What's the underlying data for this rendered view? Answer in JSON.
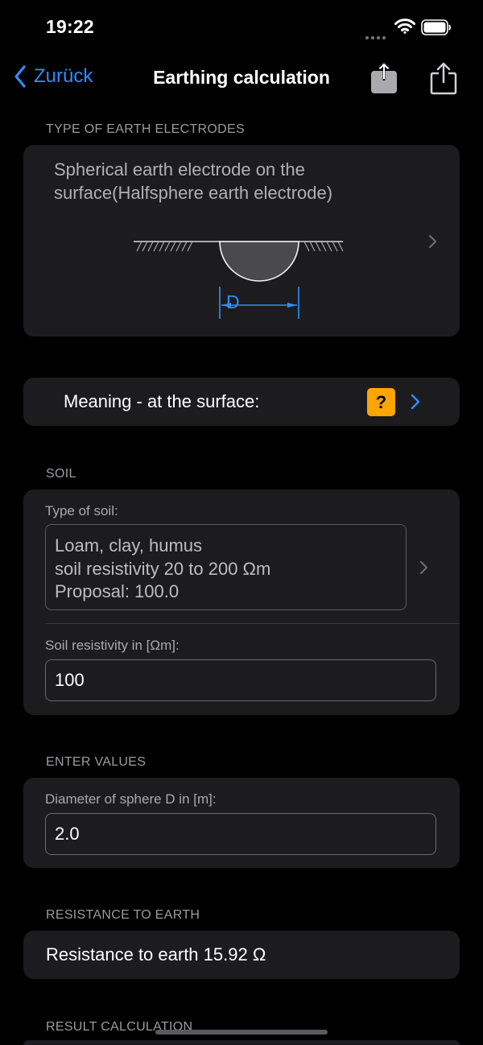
{
  "status": {
    "time": "19:22"
  },
  "nav": {
    "back_label": "Zurück",
    "title": "Earthing calculation"
  },
  "electrode_section": {
    "header": "TYPE OF EARTH ELECTRODES",
    "title": "Spherical earth electrode on the surface(Halfsphere earth electrode)",
    "dimension_label": "D"
  },
  "meaning": {
    "label": "Meaning - at the surface:",
    "help_symbol": "?"
  },
  "soil_section": {
    "header": "SOIL",
    "type_label": "Type of soil:",
    "type_lines": [
      "Loam, clay, humus",
      "soil resistivity 20 to 200 Ωm",
      "Proposal: 100.0"
    ],
    "resistivity_label": "Soil resistivity in [Ωm]:",
    "resistivity_value": "100"
  },
  "values_section": {
    "header": "ENTER VALUES",
    "diameter_label": "Diameter of sphere D in [m]:",
    "diameter_value": "2.0"
  },
  "resistance_section": {
    "header": "RESISTANCE TO EARTH",
    "result_text": "Resistance to earth 15.92 Ω"
  },
  "result_calc_section": {
    "header": "RESULT CALCULATION"
  },
  "colors": {
    "accent": "#2f8cff",
    "help_badge": "#ffa500",
    "card_bg": "#1c1c1e",
    "background": "#000000"
  }
}
